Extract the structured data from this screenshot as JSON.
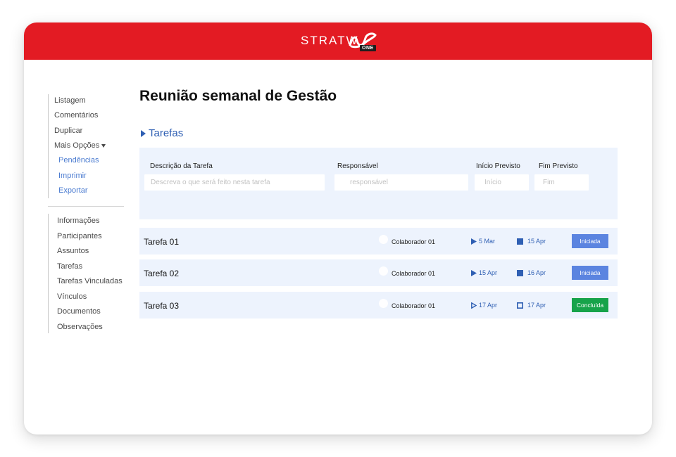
{
  "brand": {
    "name": "STRATWS",
    "logo_text": "STRATW",
    "badge": "ONE",
    "color": "#e31b23"
  },
  "sidebar": {
    "group1": [
      {
        "label": "Listagem"
      },
      {
        "label": "Comentários"
      },
      {
        "label": "Duplicar"
      },
      {
        "label": "Mais Opções"
      }
    ],
    "submenu": [
      {
        "label": "Pendências"
      },
      {
        "label": "Imprimir"
      },
      {
        "label": "Exportar"
      }
    ],
    "group2": [
      {
        "label": "Informações"
      },
      {
        "label": "Participantes"
      },
      {
        "label": "Assuntos"
      },
      {
        "label": "Tarefas"
      },
      {
        "label": "Tarefas Vinculadas"
      },
      {
        "label": "Vínculos"
      },
      {
        "label": "Documentos"
      },
      {
        "label": "Observações"
      }
    ]
  },
  "main": {
    "title": "Reunião semanal de Gestão",
    "section": "Tarefas",
    "form": {
      "desc_label": "Descrição da Tarefa",
      "desc_placeholder": "Descreva o que será feito nesta tarefa",
      "resp_label": "Responsável",
      "resp_placeholder": "responsável",
      "start_label": "Início Previsto",
      "start_placeholder": "Início",
      "end_label": "Fim Previsto",
      "end_placeholder": "Fim"
    },
    "tasks": [
      {
        "name": "Tarefa 01",
        "responsible": "Colaborador 01",
        "start": "5 Mar",
        "end": "15 Apr",
        "status": "Iniciada",
        "status_color": "#5b84e0"
      },
      {
        "name": "Tarefa 02",
        "responsible": "Colaborador 01",
        "start": "15 Apr",
        "end": "16 Apr",
        "status": "Iniciada",
        "status_color": "#5b84e0"
      },
      {
        "name": "Tarefa 03",
        "responsible": "Colaborador 01",
        "start": "17 Apr",
        "end": "17 Apr",
        "status": "Concluída",
        "status_color": "#17a34a"
      }
    ]
  },
  "colors": {
    "accent_blue": "#2f5fb3",
    "panel_bg": "#edf3fd"
  }
}
